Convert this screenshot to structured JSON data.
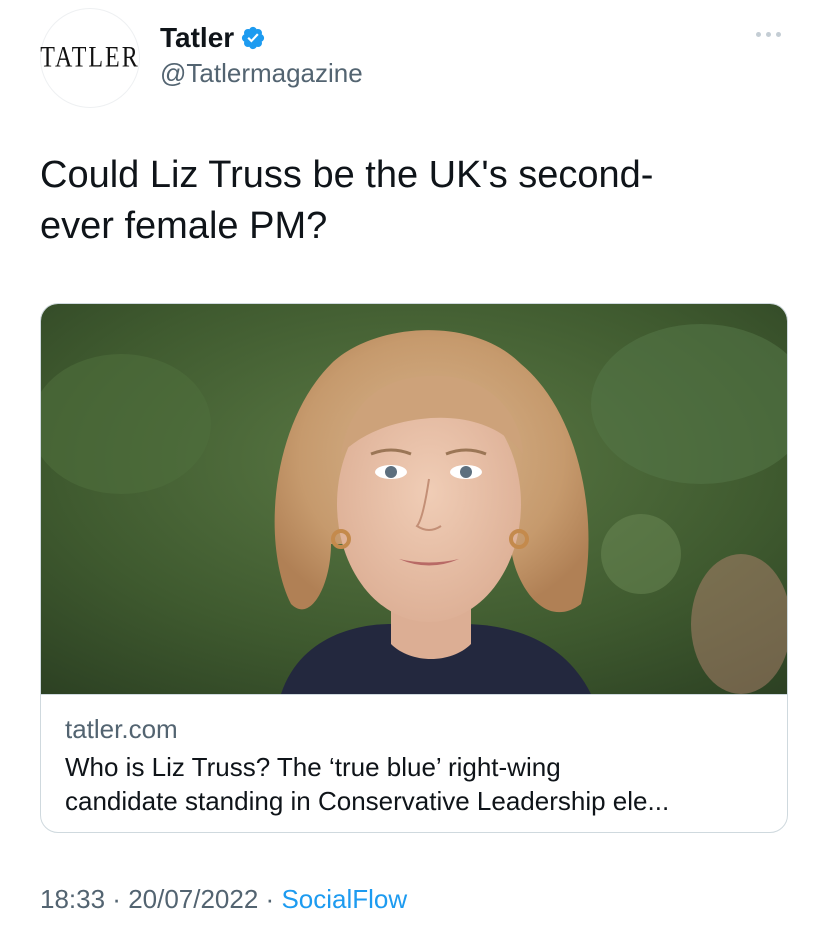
{
  "account": {
    "avatar_text": "TATLER",
    "display_name": "Tatler",
    "handle": "@Tatlermagazine",
    "verified_icon": "verified-badge-icon",
    "verified_color": "#1d9bf0"
  },
  "menu": {
    "icon": "more-dots-icon"
  },
  "tweet": {
    "text_lines": [
      "Could Liz Truss be the UK's second-",
      "ever female PM?"
    ]
  },
  "card": {
    "image_description_icon": "article-photo",
    "domain": "tatler.com",
    "title_lines": [
      "Who is Liz Truss? The ‘true blue’ right-wing",
      "candidate standing in Conservative Leadership ele..."
    ]
  },
  "meta": {
    "time": "18:33",
    "sep1": " · ",
    "date": "20/07/2022",
    "sep2": " · ",
    "source": "SocialFlow",
    "source_color": "#1d9bf0"
  }
}
